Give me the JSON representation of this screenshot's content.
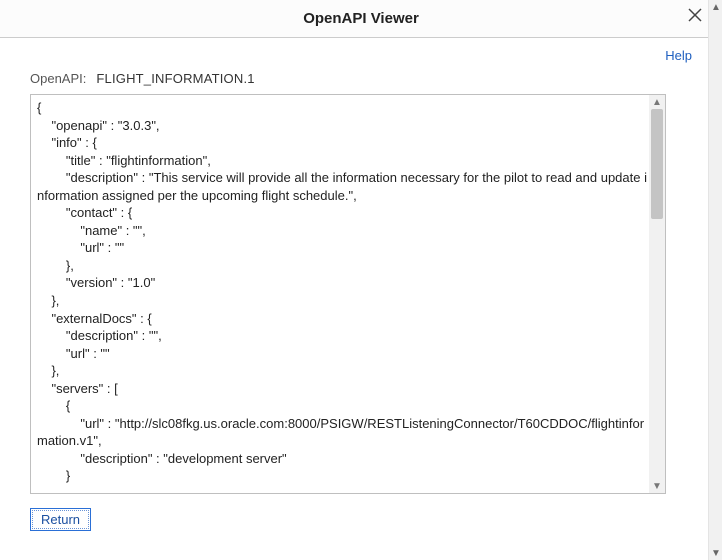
{
  "titlebar": {
    "title": "OpenAPI Viewer"
  },
  "header": {
    "help_label": "Help",
    "field_label": "OpenAPI:",
    "field_value": "FLIGHT_INFORMATION.1"
  },
  "code": {
    "text": "{\n    \"openapi\" : \"3.0.3\",\n    \"info\" : {\n        \"title\" : \"flightinformation\",\n        \"description\" : \"This service will provide all the information necessary for the pilot to read and update information assigned per the upcoming flight schedule.\",\n        \"contact\" : {\n            \"name\" : \"\",\n            \"url\" : \"\"\n        },\n        \"version\" : \"1.0\"\n    },\n    \"externalDocs\" : {\n        \"description\" : \"\",\n        \"url\" : \"\"\n    },\n    \"servers\" : [\n        {\n            \"url\" : \"http://slc08fkg.us.oracle.com:8000/PSIGW/RESTListeningConnector/T60CDDOC/flightinformation.v1\",\n            \"description\" : \"development server\"\n        }"
  },
  "buttons": {
    "return_label": "Return"
  }
}
